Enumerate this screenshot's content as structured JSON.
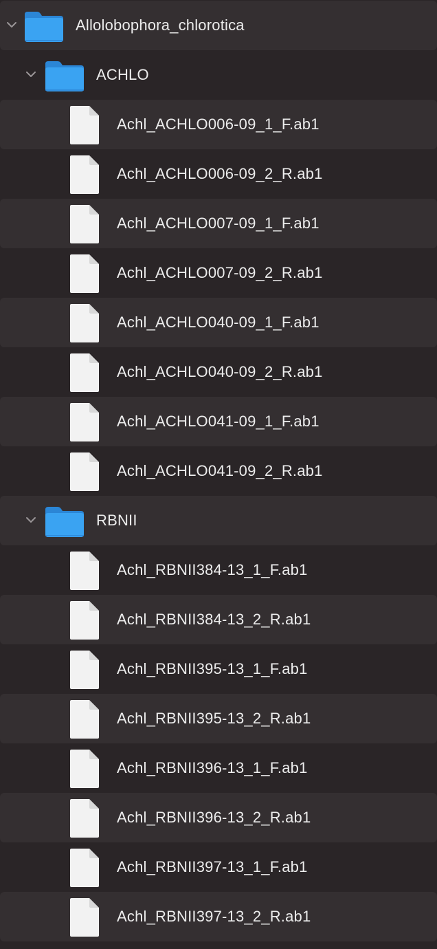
{
  "tree": {
    "root": {
      "name": "Allolobophora_chlorotica",
      "expanded": true
    },
    "folders": [
      {
        "name": "ACHLO",
        "expanded": true,
        "files": [
          "Achl_ACHLO006-09_1_F.ab1",
          "Achl_ACHLO006-09_2_R.ab1",
          "Achl_ACHLO007-09_1_F.ab1",
          "Achl_ACHLO007-09_2_R.ab1",
          "Achl_ACHLO040-09_1_F.ab1",
          "Achl_ACHLO040-09_2_R.ab1",
          "Achl_ACHLO041-09_1_F.ab1",
          "Achl_ACHLO041-09_2_R.ab1"
        ]
      },
      {
        "name": "RBNII",
        "expanded": true,
        "files": [
          "Achl_RBNII384-13_1_F.ab1",
          "Achl_RBNII384-13_2_R.ab1",
          "Achl_RBNII395-13_1_F.ab1",
          "Achl_RBNII395-13_2_R.ab1",
          "Achl_RBNII396-13_1_F.ab1",
          "Achl_RBNII396-13_2_R.ab1",
          "Achl_RBNII397-13_1_F.ab1",
          "Achl_RBNII397-13_2_R.ab1"
        ]
      }
    ]
  },
  "colors": {
    "background": "#2a2527",
    "stripe": "#342f31",
    "folder_blue": "#3aa3f2",
    "file_white": "#f2f2f2",
    "text": "#ececec",
    "chevron": "#9a9597"
  },
  "icons": {
    "disclosure": "chevron-down-icon",
    "folder": "folder-icon",
    "file": "file-icon"
  }
}
